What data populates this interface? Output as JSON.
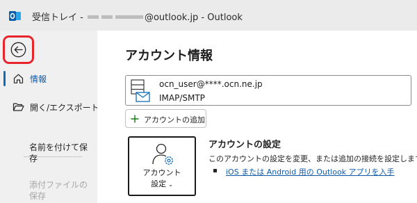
{
  "window": {
    "title_prefix": "受信トレイ - ",
    "title_suffix": "@outlook.jp  -  Outlook",
    "app_icon": "outlook-icon"
  },
  "sidebar": {
    "back_icon": "back-arrow-icon",
    "items": [
      {
        "label": "情報",
        "icon": "home-icon",
        "active": true
      },
      {
        "label": "開く/エクスポート",
        "icon": "folder-open-icon",
        "active": false
      }
    ],
    "text_items": [
      {
        "label": "名前を付けて保存",
        "disabled": false
      },
      {
        "label": "添付ファイルの保存",
        "disabled": true
      }
    ]
  },
  "main": {
    "page_title": "アカウント情報",
    "account": {
      "email": "ocn_user@****.ocn.ne.jp",
      "type": "IMAP/SMTP",
      "icon": "mail-account-icon"
    },
    "add_account_label": "アカウントの追加",
    "settings_tile": {
      "line1": "アカウント",
      "line2": "設定",
      "icon": "account-settings-icon"
    },
    "settings_heading": "アカウントの設定",
    "settings_description": "このアカウントの設定を変更、または追加の接続を設定します。",
    "settings_link": "iOS または Android 用の Outlook アプリを入手"
  },
  "colors": {
    "accent": "#0f6cbd",
    "highlight_box": "#e8242c",
    "titlebar_bg": "#ebebeb",
    "sidebar_bg": "#f0f0f0"
  }
}
